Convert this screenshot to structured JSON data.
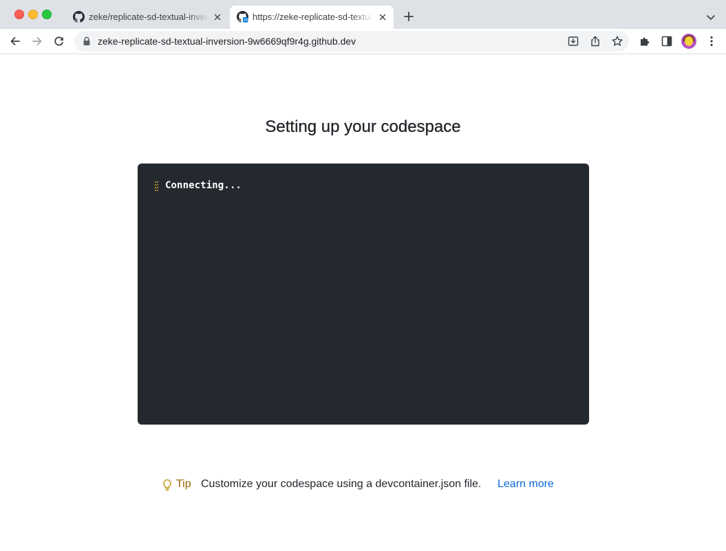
{
  "browser": {
    "tabs": [
      {
        "title": "zeke/replicate-sd-textual-inversion",
        "favicon": "github-icon",
        "active": false
      },
      {
        "title": "https://zeke-replicate-sd-textual-inversion-9w6669qf9r4g.github.dev",
        "favicon": "codespaces-icon",
        "active": true
      }
    ],
    "url": "zeke-replicate-sd-textual-inversion-9w6669qf9r4g.github.dev"
  },
  "page": {
    "heading": "Setting up your codespace",
    "terminal": {
      "status_text": "Connecting...",
      "spinner_icon": "braille-spinner-icon"
    },
    "tip": {
      "label": "Tip",
      "icon": "lightbulb-icon",
      "text": "Customize your codespace using a devcontainer.json file.",
      "link_label": "Learn more"
    }
  },
  "colors": {
    "terminal_bg": "#24292f",
    "tip_accent": "#9a6700",
    "link": "#0969da",
    "spinner": "#d4a72c"
  }
}
